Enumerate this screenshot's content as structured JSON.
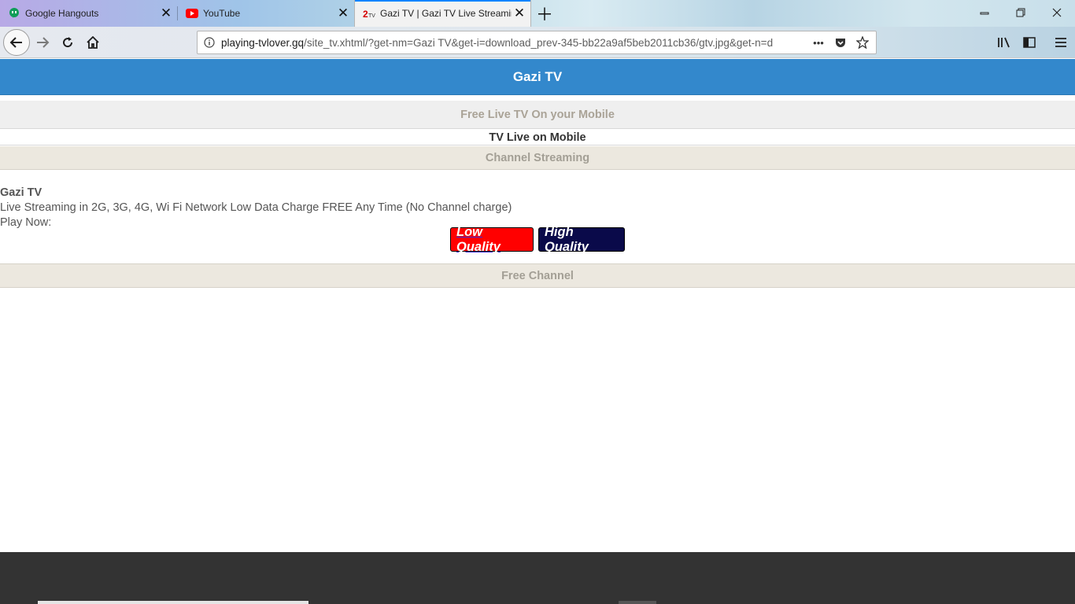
{
  "browser": {
    "tabs": [
      {
        "title": "Google Hangouts",
        "icon": "hangouts-icon"
      },
      {
        "title": "YouTube",
        "icon": "youtube-icon"
      },
      {
        "title": "Gazi TV | Gazi TV Live Streaming",
        "icon": "gazi-tv-favicon",
        "active": true
      }
    ],
    "url": {
      "host": "playing-tvlover.gq",
      "path": "/site_tv.xhtml/?get-nm=Gazi TV&get-i=download_prev-345-bb22a9af5beb2011cb36/gtv.jpg&get-n=d"
    }
  },
  "page": {
    "header_title": "Gazi TV",
    "band_free_live": "Free Live TV On your Mobile",
    "band_tv_live": "TV Live on Mobile",
    "band_channel_streaming": "Channel Streaming",
    "channel_name": "Gazi TV",
    "description": "Live Streaming in 2G, 3G, 4G, Wi Fi Network Low Data Charge FREE Any Time (No Channel charge)",
    "play_now": "Play Now:",
    "low_quality_label": "Low Quality",
    "high_quality_label": "High Quality",
    "band_free_channel": "Free Channel"
  },
  "colors": {
    "header_blue": "#3388cc",
    "low_quality_red": "#ff0000",
    "high_quality_navy": "#0a0a4a",
    "footer_dark": "#333333"
  }
}
